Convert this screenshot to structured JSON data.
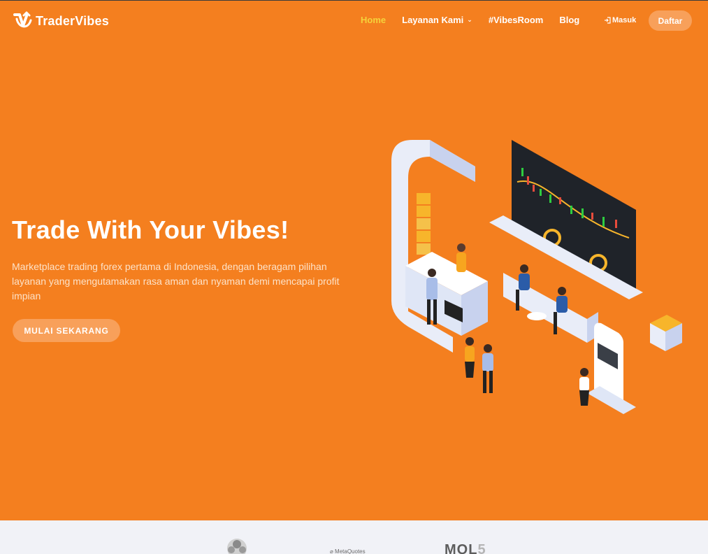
{
  "brand": {
    "name": "TraderVibes",
    "accent": "#f47f1f",
    "nav_active_color": "#f5d23a"
  },
  "nav": {
    "home": "Home",
    "services": "Layanan Kami",
    "vibesroom": "#VibesRoom",
    "blog": "Blog",
    "login": "Masuk",
    "register": "Daftar"
  },
  "hero": {
    "title": "Trade With Your Vibes!",
    "description": "Marketplace trading forex pertama di Indonesia, dengan beragam pilihan layanan yang mengutamakan rasa aman dan nyaman demi mencapai profit impian",
    "cta": "MULAI SEKARANG"
  },
  "partners": {
    "metaquotes": "MetaQuotes",
    "mql_main": "MQL",
    "mql_num": "5"
  }
}
